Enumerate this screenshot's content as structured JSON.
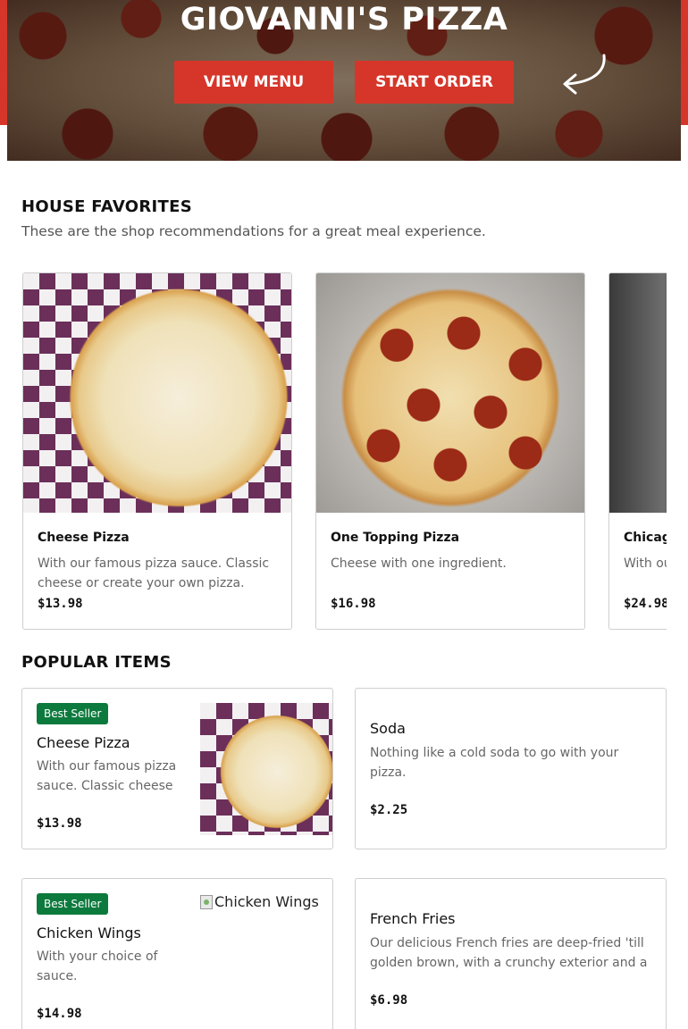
{
  "hero": {
    "title": "GIOVANNI'S PIZZA",
    "view_menu_label": "VIEW MENU",
    "start_order_label": "START ORDER",
    "arrow_icon": "curved-arrow-icon"
  },
  "favorites": {
    "title": "HOUSE FAVORITES",
    "subtitle": "These are the shop recommendations for a great meal experience.",
    "items": [
      {
        "name": "Cheese Pizza",
        "desc": "With our famous pizza sauce. Classic cheese or create your own pizza.",
        "price": "$13.98"
      },
      {
        "name": "One Topping Pizza",
        "desc": "Cheese with one ingredient.",
        "price": "$16.98"
      },
      {
        "name": "Chicago",
        "desc": "With ou",
        "price": "$24.98"
      }
    ]
  },
  "popular": {
    "title": "POPULAR ITEMS",
    "items": [
      {
        "badge": "Best Seller",
        "name": "Cheese Pizza",
        "desc": "With our famous pizza sauce. Classic cheese o...",
        "price": "$13.98"
      },
      {
        "badge": "",
        "name": "Soda",
        "desc": "Nothing like a cold soda to go with your pizza.",
        "price": "$2.25"
      },
      {
        "badge": "Best Seller",
        "name": "Chicken Wings",
        "desc": "With your choice of sauce.",
        "price": "$14.98",
        "image_alt": "Chicken Wings"
      },
      {
        "badge": "",
        "name": "French Fries",
        "desc": "Our delicious French fries are deep-fried 'till golden brown, with a crunchy exterior and a lig...",
        "price": "$6.98"
      }
    ]
  },
  "colors": {
    "brand_red": "#d6362a",
    "badge_green": "#0d7a3d"
  }
}
